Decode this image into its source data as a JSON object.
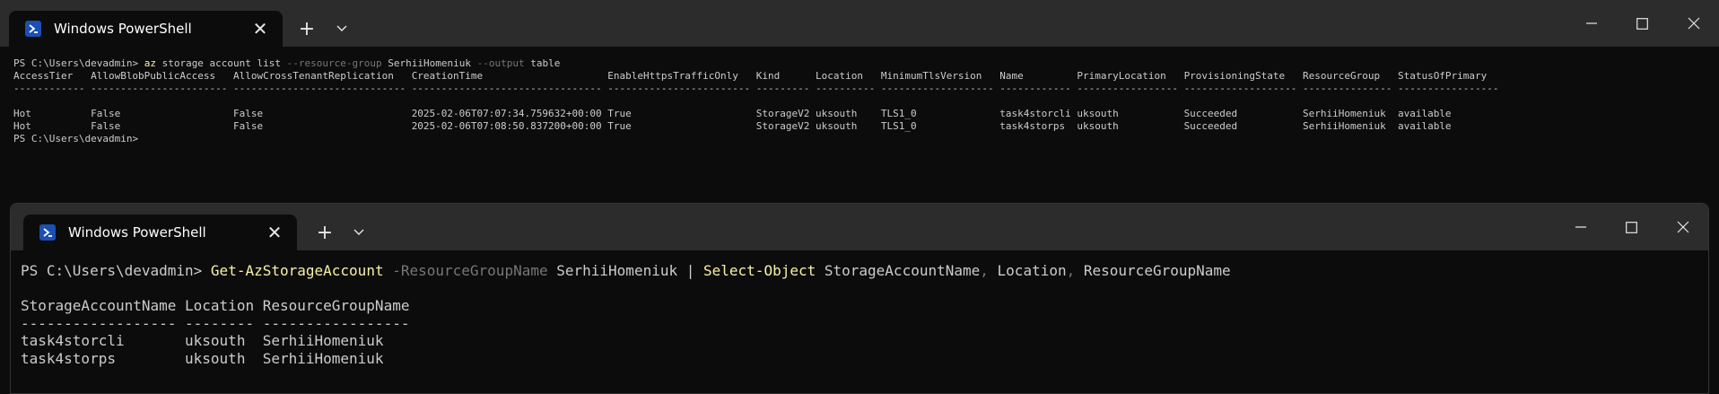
{
  "window1": {
    "tab_title": "Windows PowerShell",
    "icon": "powershell-icon",
    "prompt": "PS C:\\Users\\devadmin> ",
    "command": {
      "exe": "az",
      "args1": " storage account list ",
      "param1": "--resource-group",
      "value1": " SerhiiHomeniuk ",
      "param2": "--output",
      "value2": " table"
    },
    "table": {
      "columns": [
        "AccessTier",
        "AllowBlobPublicAccess",
        "AllowCrossTenantReplication",
        "CreationTime",
        "EnableHttpsTrafficOnly",
        "Kind",
        "Location",
        "MinimumTlsVersion",
        "Name",
        "PrimaryLocation",
        "ProvisioningState",
        "ResourceGroup",
        "StatusOfPrimary"
      ],
      "underlines": [
        "------------",
        "-----------------------",
        "-----------------------------",
        "--------------------------------",
        "------------------------",
        "---------",
        "----------",
        "-------------------",
        "------------",
        "-----------------",
        "-------------------",
        "---------------",
        "-----------------"
      ],
      "rows": [
        [
          "Hot",
          "False",
          "False",
          "2025-02-06T07:07:34.759632+00:00",
          "True",
          "StorageV2",
          "uksouth",
          "TLS1_0",
          "task4storcli",
          "uksouth",
          "Succeeded",
          "SerhiiHomeniuk",
          "available"
        ],
        [
          "Hot",
          "False",
          "False",
          "2025-02-06T07:08:50.837200+00:00",
          "True",
          "StorageV2",
          "uksouth",
          "TLS1_0",
          "task4storps",
          "uksouth",
          "Succeeded",
          "SerhiiHomeniuk",
          "available"
        ]
      ]
    },
    "final_prompt": "PS C:\\Users\\devadmin>"
  },
  "window2": {
    "tab_title": "Windows PowerShell",
    "icon": "powershell-icon",
    "prompt": "PS C:\\Users\\devadmin> ",
    "command": {
      "cmdlet1": "Get-AzStorageAccount",
      "param1": " -ResourceGroupName",
      "value1": " SerhiiHomeniuk ",
      "pipe": "|",
      "cmdlet2": " Select-Object",
      "arg_a": " StorageAccountName",
      "comma1": ",",
      "arg_b": " Location",
      "comma2": ",",
      "arg_c": " ResourceGroupName"
    },
    "table": {
      "columns": [
        "StorageAccountName",
        "Location",
        "ResourceGroupName"
      ],
      "underlines": [
        "------------------",
        "--------",
        "-----------------"
      ],
      "rows": [
        [
          "task4storcli",
          "uksouth",
          "SerhiiHomeniuk"
        ],
        [
          "task4storps",
          "uksouth",
          "SerhiiHomeniuk"
        ]
      ]
    }
  },
  "controls": {
    "new_tab": "+",
    "dropdown": "⌄",
    "close_tab": "✕"
  },
  "colors": {
    "background": "#0c0c0c",
    "titlebar": "#2c2c2c",
    "text": "#cccccc",
    "cmdlet": "#f9f1a5",
    "parameter": "#767676",
    "icon_blue": "#1b4fb3"
  }
}
